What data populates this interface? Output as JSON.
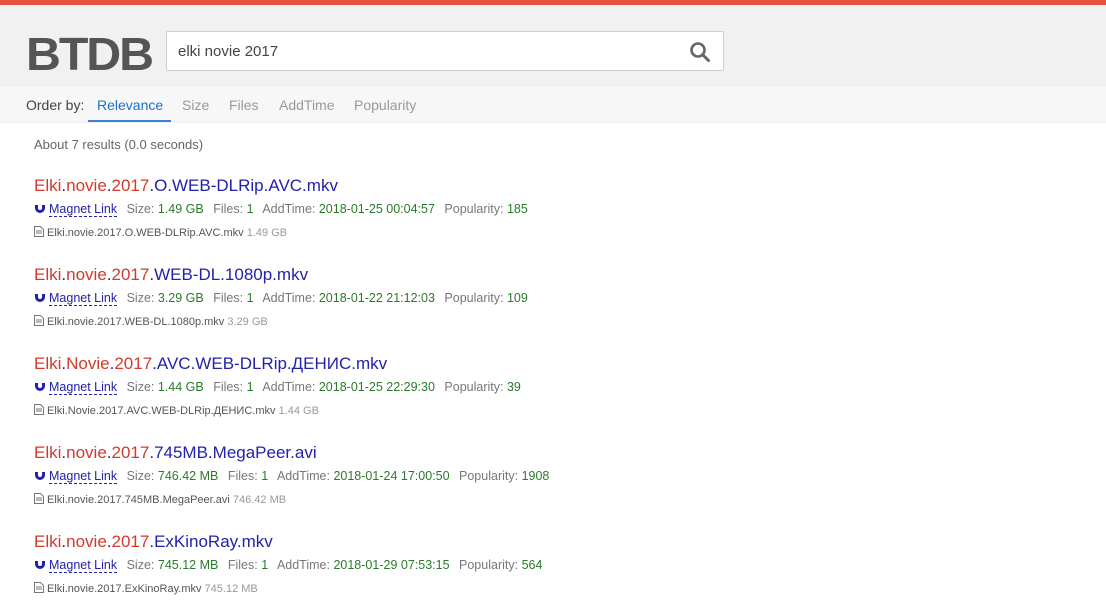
{
  "header": {
    "logo_text": "BTDB",
    "search_value": "elki novie 2017",
    "search_placeholder": ""
  },
  "order": {
    "label": "Order by:",
    "tabs": [
      "Relevance",
      "Size",
      "Files",
      "AddTime",
      "Popularity"
    ],
    "active": "Relevance"
  },
  "results_info": "About 7 results (0.0 seconds)",
  "meta_labels": {
    "magnet": "Magnet Link",
    "size": "Size:",
    "files": "Files:",
    "addtime": "AddTime:",
    "popularity": "Popularity:"
  },
  "results": [
    {
      "title_hl1": "Elki",
      "title_d1": ".",
      "title_hl2": "novie",
      "title_d2": ".",
      "title_hl3": "2017",
      "title_rest": ".O.WEB-DLRip.AVC.mkv",
      "size": "1.49 GB",
      "files": "1",
      "addtime": "2018-01-25 00:04:57",
      "popularity": "185",
      "file_name": "Elki.novie.2017.O.WEB-DLRip.AVC.mkv",
      "file_size": "1.49 GB"
    },
    {
      "title_hl1": "Elki",
      "title_d1": ".",
      "title_hl2": "novie",
      "title_d2": ".",
      "title_hl3": "2017",
      "title_rest": ".WEB-DL.1080p.mkv",
      "size": "3.29 GB",
      "files": "1",
      "addtime": "2018-01-22 21:12:03",
      "popularity": "109",
      "file_name": "Elki.novie.2017.WEB-DL.1080p.mkv",
      "file_size": "3.29 GB"
    },
    {
      "title_hl1": "Elki",
      "title_d1": ".",
      "title_hl2": "Novie",
      "title_d2": ".",
      "title_hl3": "2017",
      "title_rest": ".AVC.WEB-DLRip.ДЕНИС.mkv",
      "size": "1.44 GB",
      "files": "1",
      "addtime": "2018-01-25 22:29:30",
      "popularity": "39",
      "file_name": "Elki.Novie.2017.AVC.WEB-DLRip.ДЕНИС.mkv",
      "file_size": "1.44 GB"
    },
    {
      "title_hl1": "Elki",
      "title_d1": ".",
      "title_hl2": "novie",
      "title_d2": ".",
      "title_hl3": "2017",
      "title_rest": ".745MB.MegaPeer.avi",
      "size": "746.42 MB",
      "files": "1",
      "addtime": "2018-01-24 17:00:50",
      "popularity": "1908",
      "file_name": "Elki.novie.2017.745MB.MegaPeer.avi",
      "file_size": "746.42 MB"
    },
    {
      "title_hl1": "Elki",
      "title_d1": ".",
      "title_hl2": "novie",
      "title_d2": ".",
      "title_hl3": "2017",
      "title_rest": ".ExKinoRay.mkv",
      "size": "745.12 MB",
      "files": "1",
      "addtime": "2018-01-29 07:53:15",
      "popularity": "564",
      "file_name": "Elki.novie.2017.ExKinoRay.mkv",
      "file_size": "745.12 MB"
    }
  ],
  "colors": {
    "accent_bar": "#e5533c",
    "highlight": "#d33a2c",
    "link": "#2222aa",
    "value_green": "#2b7a2b",
    "active_tab": "#1a73c9"
  },
  "icons": {
    "search": "search-icon",
    "magnet": "magnet-icon",
    "file": "file-icon"
  }
}
